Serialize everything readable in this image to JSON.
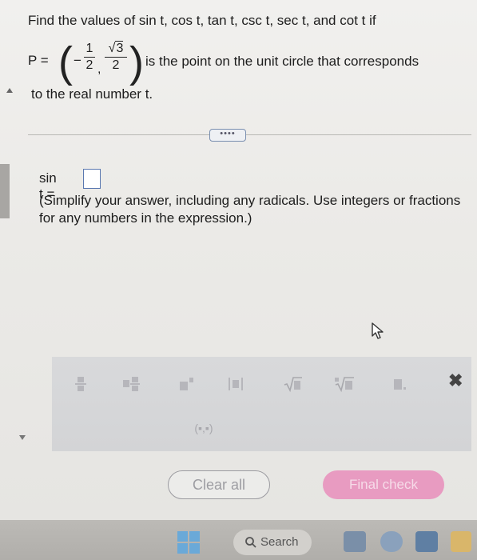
{
  "question": {
    "line1": "Find the values of sin t, cos t, tan t, csc t, sec t, and cot t if",
    "p_label": "P =",
    "minus": "−",
    "frac1_num": "1",
    "frac1_den": "2",
    "comma": ",",
    "sqrt_symbol": "√",
    "radicand": "3",
    "frac2_den": "2",
    "p_desc": "is the point on the unit circle that corresponds",
    "line3": "to the real number t."
  },
  "more_pill": "••••",
  "answer": {
    "label": "sin t =",
    "hint": "(Simplify your answer, including any radicals. Use integers or fractions for any numbers in the expression.)"
  },
  "toolbar": {
    "buttons": [
      {
        "icon": "fraction-icon"
      },
      {
        "icon": "mixed-number-icon"
      },
      {
        "icon": "exponent-icon"
      },
      {
        "icon": "absolute-value-icon"
      },
      {
        "icon": "square-root-icon"
      },
      {
        "icon": "nth-root-icon"
      },
      {
        "icon": "decimal-icon"
      },
      {
        "icon": "ordered-pair-icon",
        "label": "(▪,▪)"
      }
    ],
    "close_symbol": "✖"
  },
  "actions": {
    "clear_all": "Clear all",
    "final_check": "Final check"
  },
  "taskbar": {
    "search_label": "Search"
  },
  "colors": {
    "final_check_bg": "#e89bc1",
    "answer_box_border": "#5a78b0",
    "windows_blue": "#6aa9d8"
  }
}
